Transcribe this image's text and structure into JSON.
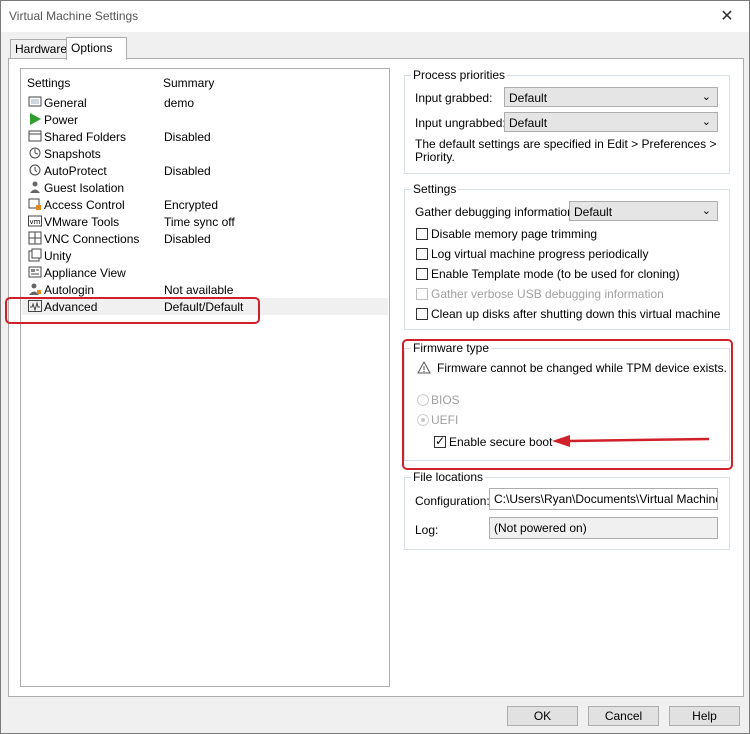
{
  "window": {
    "title": "Virtual Machine Settings",
    "close_glyph": "✕"
  },
  "tabs": [
    {
      "label": "Hardware"
    },
    {
      "label": "Options"
    }
  ],
  "list": {
    "headers": {
      "settings": "Settings",
      "summary": "Summary"
    },
    "items": [
      {
        "name": "General",
        "summary": "demo",
        "icon": "general-icon"
      },
      {
        "name": "Power",
        "summary": "",
        "icon": "power-icon"
      },
      {
        "name": "Shared Folders",
        "summary": "Disabled",
        "icon": "shared-folders-icon"
      },
      {
        "name": "Snapshots",
        "summary": "",
        "icon": "snapshots-icon"
      },
      {
        "name": "AutoProtect",
        "summary": "Disabled",
        "icon": "autoprotect-icon"
      },
      {
        "name": "Guest Isolation",
        "summary": "",
        "icon": "guest-isolation-icon"
      },
      {
        "name": "Access Control",
        "summary": "Encrypted",
        "icon": "access-control-icon"
      },
      {
        "name": "VMware Tools",
        "summary": "Time sync off",
        "icon": "vmware-tools-icon"
      },
      {
        "name": "VNC Connections",
        "summary": "Disabled",
        "icon": "vnc-icon"
      },
      {
        "name": "Unity",
        "summary": "",
        "icon": "unity-icon"
      },
      {
        "name": "Appliance View",
        "summary": "",
        "icon": "appliance-view-icon"
      },
      {
        "name": "Autologin",
        "summary": "Not available",
        "icon": "autologin-icon"
      },
      {
        "name": "Advanced",
        "summary": "Default/Default",
        "icon": "advanced-icon",
        "selected": true
      }
    ]
  },
  "process_priorities": {
    "title": "Process priorities",
    "input_grabbed_label": "Input grabbed:",
    "input_grabbed_value": "Default",
    "input_ungrabbed_label": "Input ungrabbed:",
    "input_ungrabbed_value": "Default",
    "note": "The default settings are specified in Edit > Preferences >",
    "note2": "Priority."
  },
  "settings": {
    "title": "Settings",
    "debug_label": "Gather debugging information:",
    "debug_value": "Default",
    "checkboxes": [
      {
        "label": "Disable memory page trimming",
        "checked": false,
        "disabled": false
      },
      {
        "label": "Log virtual machine progress periodically",
        "checked": false,
        "disabled": false
      },
      {
        "label": "Enable Template mode (to be used for cloning)",
        "checked": false,
        "disabled": false
      },
      {
        "label": "Gather verbose USB debugging information",
        "checked": false,
        "disabled": true
      },
      {
        "label": "Clean up disks after shutting down this virtual machine",
        "checked": false,
        "disabled": false
      }
    ]
  },
  "firmware": {
    "title": "Firmware type",
    "warning": "Firmware cannot be changed while TPM device exists.",
    "bios_label": "BIOS",
    "uefi_label": "UEFI",
    "uefi_selected": true,
    "secure_boot_label": "Enable secure boot",
    "secure_boot_checked": true
  },
  "file_locations": {
    "title": "File locations",
    "config_label": "Configuration:",
    "config_value": "C:\\Users\\Ryan\\Documents\\Virtual Machines\\de",
    "log_label": "Log:",
    "log_value": "(Not powered on)"
  },
  "buttons": {
    "ok": "OK",
    "cancel": "Cancel",
    "help": "Help"
  },
  "colors": {
    "highlight": "#d0202a",
    "power_green": "#2e9e2e"
  }
}
